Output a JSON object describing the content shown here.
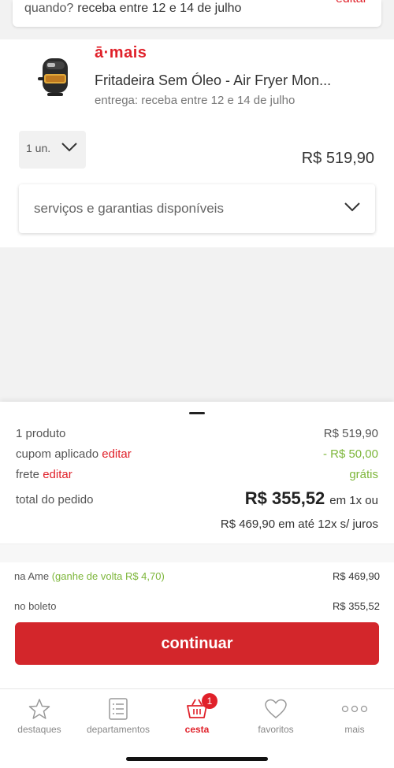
{
  "delivery_card": {
    "question": "quando?",
    "value": "receba entre 12 e 14 de julho",
    "edit": "editar"
  },
  "product": {
    "brand": "ā·mais",
    "name": "Fritadeira Sem Óleo - Air Fryer Mon...",
    "delivery": "entrega: receba entre 12 e 14 de julho",
    "quantity": "1 un.",
    "price": "R$ 519,90",
    "services": "serviços e garantias disponíveis"
  },
  "summary": {
    "products_label": "1 produto",
    "products_value": "R$ 519,90",
    "coupon_label": "cupom aplicado",
    "coupon_edit": "editar",
    "coupon_value": "- R$ 50,00",
    "shipping_label": "frete",
    "shipping_edit": "editar",
    "shipping_value": "grátis",
    "total_label": "total do pedido",
    "total_value": "R$ 355,52",
    "total_suffix": "em 1x ou",
    "installments": "R$ 469,90 em até 12x s/ juros"
  },
  "payment_options": {
    "ame_label": "na Ame",
    "ame_cashback": "(ganhe de volta R$ 4,70)",
    "ame_value": "R$ 469,90",
    "boleto_label": "no boleto",
    "boleto_value": "R$ 355,52"
  },
  "continue_label": "continuar",
  "tabs": [
    {
      "label": "destaques",
      "icon": "star-icon"
    },
    {
      "label": "departamentos",
      "icon": "list-icon"
    },
    {
      "label": "cesta",
      "icon": "basket-icon",
      "badge": "1",
      "active": true
    },
    {
      "label": "favoritos",
      "icon": "heart-icon"
    },
    {
      "label": "mais",
      "icon": "more-icon"
    }
  ],
  "colors": {
    "accent": "#e0212a",
    "button": "#d3262b",
    "green": "#7db63a"
  }
}
